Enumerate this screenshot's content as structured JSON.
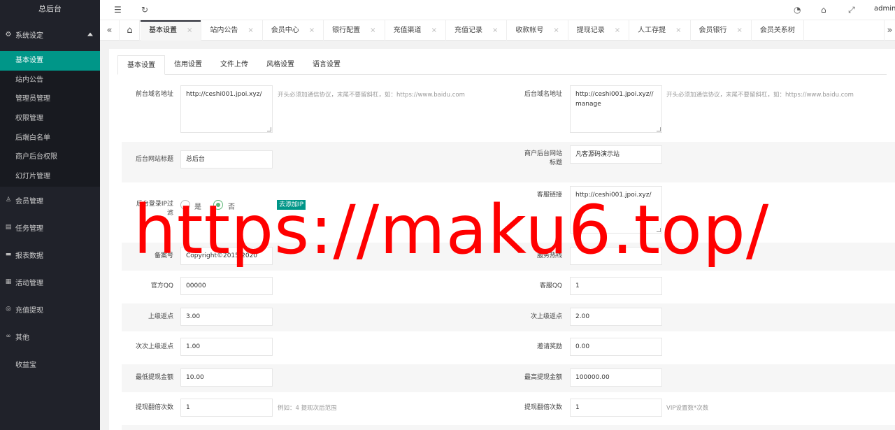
{
  "sidebar": {
    "logo": "总后台",
    "system_group": "系统设定",
    "system_items": [
      "基本设置",
      "站内公告",
      "管理员管理",
      "权限管理",
      "后端白名单",
      "商户后台权限",
      "幻灯片管理"
    ],
    "groups": [
      "会员管理",
      "任务管理",
      "报表数据",
      "活动管理",
      "充值提现",
      "其他",
      "收益宝"
    ]
  },
  "header": {
    "user": "admin"
  },
  "tabs": [
    {
      "label": "基本设置"
    },
    {
      "label": "站内公告"
    },
    {
      "label": "会员中心"
    },
    {
      "label": "银行配置"
    },
    {
      "label": "充值渠道"
    },
    {
      "label": "充值记录"
    },
    {
      "label": "收款帐号"
    },
    {
      "label": "提现记录"
    },
    {
      "label": "人工存提"
    },
    {
      "label": "会员银行"
    },
    {
      "label": "会员关系树"
    }
  ],
  "subtabs": [
    "基本设置",
    "信用设置",
    "文件上传",
    "风格设置",
    "语言设置"
  ],
  "form": {
    "front_domain_label": "前台域名地址",
    "front_domain_value": "http://ceshi001.jpoi.xyz/",
    "front_domain_hint": "开头必须加通信协议，末尾不要留斜杠，如：https://www.baidu.com",
    "back_domain_label": "后台域名地址",
    "back_domain_value": "http://ceshi001.jpoi.xyz//manage",
    "back_domain_hint": "开头必须加通信协议，末尾不要留斜杠，如：https://www.baidu.com",
    "admin_title_label": "后台网站标题",
    "admin_title_value": "总后台",
    "merchant_title_label": "商户后台网站标题",
    "merchant_title_value": "凡客源码演示站",
    "ip_filter_label": "后台登录IP过滤",
    "ip_yes": "是",
    "ip_no": "否",
    "add_ip_btn": "去添加IP",
    "service_link_label": "客服链接",
    "service_link_value": "http://ceshi001.jpoi.xyz/",
    "record_label": "备案号",
    "record_value": "Copyright©2015-2020",
    "hotline_label": "服务热线",
    "qq_label": "官方QQ",
    "qq_value": "00000",
    "service_qq_label": "客服QQ",
    "service_qq_value": "1",
    "rebate1_label": "上级返点",
    "rebate1_value": "3.00",
    "rebate2_label": "次上级返点",
    "rebate2_value": "2.00",
    "rebate3_label": "次次上级返点",
    "rebate3_value": "1.00",
    "invite_label": "邀请奖励",
    "invite_value": "0.00",
    "min_withdraw_label": "最低提现金额",
    "min_withdraw_value": "10.00",
    "max_withdraw_label": "最高提现金额",
    "max_withdraw_value": "100000.00",
    "withdraw_times_label": "提现翻倍次数",
    "withdraw_times_value": "1",
    "withdraw_times_hint": "例如：4 提现次后范围",
    "withdraw_times2_label": "提现翻倍次数",
    "withdraw_times2_value": "1",
    "withdraw_times2_hint": "VIP设置数*次数"
  },
  "watermark": "https://maku6.top/"
}
